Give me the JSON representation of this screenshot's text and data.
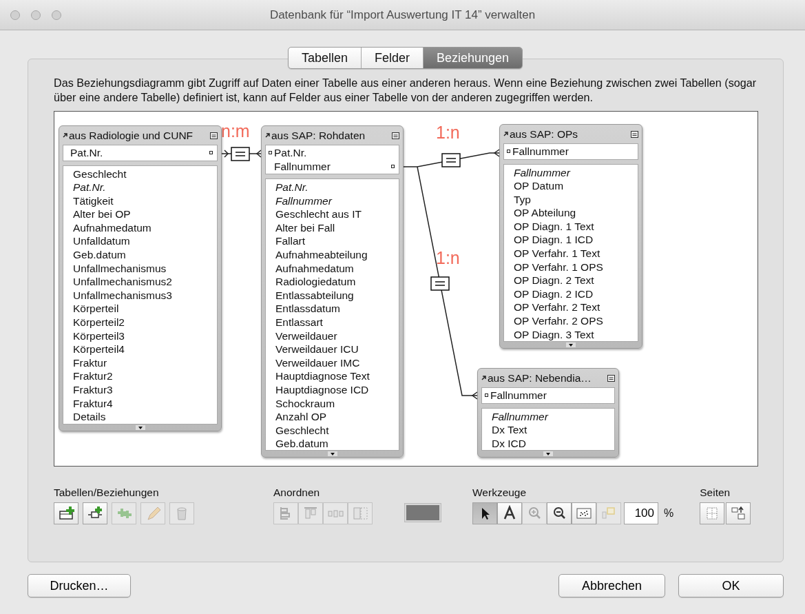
{
  "window": {
    "title": "Datenbank für “Import Auswertung IT 14” verwalten"
  },
  "tabs": [
    {
      "label": "Tabellen",
      "selected": false
    },
    {
      "label": "Felder",
      "selected": false
    },
    {
      "label": "Beziehungen",
      "selected": true
    }
  ],
  "description": "Das Beziehungsdiagramm gibt Zugriff auf Daten einer Tabelle aus einer anderen heraus. Wenn eine Beziehung zwischen zwei Tabellen (sogar über eine andere Tabelle) definiert ist, kann auf Felder aus einer Tabelle von der anderen zugegriffen werden.",
  "diagram": {
    "tables": [
      {
        "title": "aus Radiologie und CUNF",
        "keys": [
          "Pat.Nr."
        ],
        "fields": [
          {
            "label": "Geschlecht",
            "italic": false
          },
          {
            "label": "Pat.Nr.",
            "italic": true
          },
          {
            "label": "Tätigkeit",
            "italic": false
          },
          {
            "label": "Alter bei OP",
            "italic": false
          },
          {
            "label": "Aufnahmedatum",
            "italic": false
          },
          {
            "label": "Unfalldatum",
            "italic": false
          },
          {
            "label": "Geb.datum",
            "italic": false
          },
          {
            "label": "Unfallmechanismus",
            "italic": false
          },
          {
            "label": "Unfallmechanismus2",
            "italic": false
          },
          {
            "label": "Unfallmechanismus3",
            "italic": false
          },
          {
            "label": "Körperteil",
            "italic": false
          },
          {
            "label": "Körperteil2",
            "italic": false
          },
          {
            "label": "Körperteil3",
            "italic": false
          },
          {
            "label": "Körperteil4",
            "italic": false
          },
          {
            "label": "Fraktur",
            "italic": false
          },
          {
            "label": "Fraktur2",
            "italic": false
          },
          {
            "label": "Fraktur3",
            "italic": false
          },
          {
            "label": "Fraktur4",
            "italic": false
          },
          {
            "label": "Details",
            "italic": false
          }
        ]
      },
      {
        "title": "aus SAP: Rohdaten",
        "keys": [
          "Pat.Nr.",
          "Fallnummer"
        ],
        "fields": [
          {
            "label": "Pat.Nr.",
            "italic": true
          },
          {
            "label": "Fallnummer",
            "italic": true
          },
          {
            "label": "Geschlecht aus IT",
            "italic": false
          },
          {
            "label": "Alter bei Fall",
            "italic": false
          },
          {
            "label": "Fallart",
            "italic": false
          },
          {
            "label": "Aufnahmeabteilung",
            "italic": false
          },
          {
            "label": "Aufnahmedatum",
            "italic": false
          },
          {
            "label": "Radiologiedatum",
            "italic": false
          },
          {
            "label": "Entlassabteilung",
            "italic": false
          },
          {
            "label": "Entlassdatum",
            "italic": false
          },
          {
            "label": "Entlassart",
            "italic": false
          },
          {
            "label": "Verweildauer",
            "italic": false
          },
          {
            "label": "Verweildauer ICU",
            "italic": false
          },
          {
            "label": "Verweildauer IMC",
            "italic": false
          },
          {
            "label": "Hauptdiagnose Text",
            "italic": false
          },
          {
            "label": "Hauptdiagnose ICD",
            "italic": false
          },
          {
            "label": "Schockraum",
            "italic": false
          },
          {
            "label": "Anzahl OP",
            "italic": false
          },
          {
            "label": "Geschlecht",
            "italic": false
          },
          {
            "label": "Geb.datum",
            "italic": false
          }
        ]
      },
      {
        "title": "aus SAP: OPs",
        "keys": [
          "Fallnummer"
        ],
        "fields": [
          {
            "label": "Fallnummer",
            "italic": true
          },
          {
            "label": "OP Datum",
            "italic": false
          },
          {
            "label": "Typ",
            "italic": false
          },
          {
            "label": "OP Abteilung",
            "italic": false
          },
          {
            "label": "OP Diagn. 1 Text",
            "italic": false
          },
          {
            "label": "OP Diagn. 1 ICD",
            "italic": false
          },
          {
            "label": "OP Verfahr. 1 Text",
            "italic": false
          },
          {
            "label": "OP Verfahr. 1 OPS",
            "italic": false
          },
          {
            "label": "OP Diagn. 2 Text",
            "italic": false
          },
          {
            "label": "OP Diagn. 2 ICD",
            "italic": false
          },
          {
            "label": "OP Verfahr. 2 Text",
            "italic": false
          },
          {
            "label": "OP Verfahr. 2 OPS",
            "italic": false
          },
          {
            "label": "OP Diagn. 3 Text",
            "italic": false
          }
        ]
      },
      {
        "title": "aus SAP: Nebendia…",
        "keys": [
          "Fallnummer"
        ],
        "fields": [
          {
            "label": "Fallnummer",
            "italic": true
          },
          {
            "label": "Dx Text",
            "italic": false
          },
          {
            "label": "Dx ICD",
            "italic": false
          }
        ]
      }
    ],
    "relationships": [
      {
        "label": "n:m"
      },
      {
        "label": "1:n"
      },
      {
        "label": "1:n"
      }
    ]
  },
  "toolbar": {
    "tables_group": {
      "label": "Tabellen/Beziehungen",
      "buttons": [
        {
          "disabled": false
        },
        {
          "disabled": false
        },
        {
          "disabled": true
        },
        {
          "disabled": true
        },
        {
          "disabled": true
        }
      ]
    },
    "arrange_group": {
      "label": "Anordnen",
      "buttons": [
        {
          "disabled": true
        },
        {
          "disabled": true
        },
        {
          "disabled": true
        },
        {
          "disabled": true
        }
      ]
    },
    "tools_group": {
      "label": "Werkzeuge",
      "buttons": [
        {
          "selected": true,
          "disabled": false
        },
        {
          "selected": false,
          "disabled": false
        },
        {
          "selected": false,
          "disabled": true
        },
        {
          "selected": false,
          "disabled": false
        },
        {
          "selected": false,
          "disabled": false
        },
        {
          "selected": false,
          "disabled": true
        }
      ],
      "zoom_value": "100",
      "zoom_unit": "%"
    },
    "pages_group": {
      "label": "Seiten",
      "buttons": [
        {
          "disabled": false
        },
        {
          "disabled": false
        }
      ]
    }
  },
  "buttons": {
    "print": "Drucken…",
    "cancel": "Abbrechen",
    "ok": "OK"
  }
}
